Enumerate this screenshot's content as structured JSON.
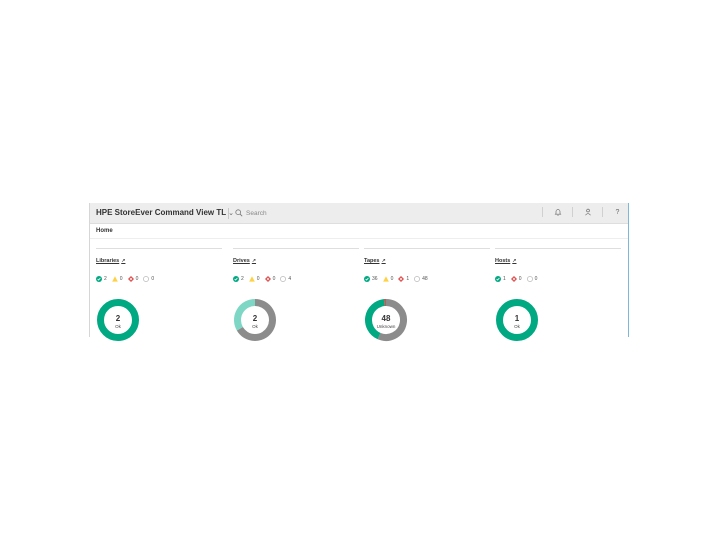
{
  "app": {
    "title": "HPE StoreEver Command View TL"
  },
  "search": {
    "placeholder": "Search"
  },
  "breadcrumb": "Home",
  "colors": {
    "ok": "#01a982",
    "warning": "#ffd144",
    "critical": "#e04b4b",
    "unknown": "#8c8c8c",
    "secondary": "#7ed7c4"
  },
  "cards": [
    {
      "title": "Libraries",
      "ok": "2",
      "warning": "0",
      "critical": "0",
      "unknown": "0",
      "center_value": "2",
      "center_label": "Ok",
      "segments": [
        {
          "status": "ok",
          "value": 2
        }
      ]
    },
    {
      "title": "Drives",
      "ok": "2",
      "warning": "0",
      "critical": "0",
      "unknown": "4",
      "center_value": "2",
      "center_label": "Ok",
      "segments": [
        {
          "status": "unknown",
          "value": 4
        },
        {
          "status": "secondary",
          "value": 2
        }
      ]
    },
    {
      "title": "Tapes",
      "ok": "36",
      "warning": "0",
      "critical": "1",
      "unknown": "48",
      "center_value": "48",
      "center_label": "Unknown",
      "segments": [
        {
          "status": "unknown",
          "value": 48
        },
        {
          "status": "ok",
          "value": 36
        },
        {
          "status": "critical",
          "value": 1
        }
      ]
    },
    {
      "title": "Hosts",
      "ok": "1",
      "critical": "0",
      "unknown": "0",
      "center_value": "1",
      "center_label": "Ok",
      "segments": [
        {
          "status": "ok",
          "value": 1
        }
      ]
    }
  ]
}
